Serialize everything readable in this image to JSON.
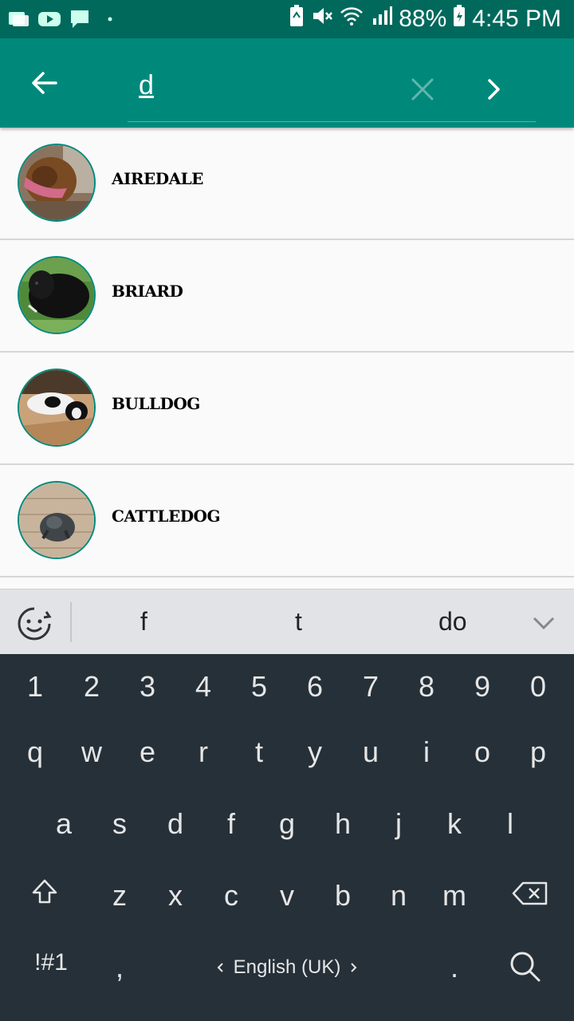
{
  "status_bar": {
    "battery": "88%",
    "time": "4:45 PM",
    "icons": [
      "photo-icon",
      "youtube-icon",
      "chat-icon",
      "dot-icon",
      "battery-saver-icon",
      "mute-icon",
      "wifi-icon",
      "signal-icon",
      "battery-icon"
    ]
  },
  "search": {
    "query": "d",
    "back_icon": "arrow-back-icon",
    "clear_icon": "close-icon",
    "next_icon": "chevron-right-icon"
  },
  "breeds": [
    {
      "name": "AIREDALE"
    },
    {
      "name": "BRIARD"
    },
    {
      "name": "BULLDOG"
    },
    {
      "name": "CATTLEDOG"
    }
  ],
  "keyboard": {
    "suggestions": [
      "f",
      "t",
      "do"
    ],
    "number_row": [
      "1",
      "2",
      "3",
      "4",
      "5",
      "6",
      "7",
      "8",
      "9",
      "0"
    ],
    "row1": [
      "q",
      "w",
      "e",
      "r",
      "t",
      "y",
      "u",
      "i",
      "o",
      "p"
    ],
    "row2": [
      "a",
      "s",
      "d",
      "f",
      "g",
      "h",
      "j",
      "k",
      "l"
    ],
    "row3": [
      "z",
      "x",
      "c",
      "v",
      "b",
      "n",
      "m"
    ],
    "symbols_label": "!#1",
    "comma": ",",
    "space_label": "English (UK)",
    "period": "."
  }
}
